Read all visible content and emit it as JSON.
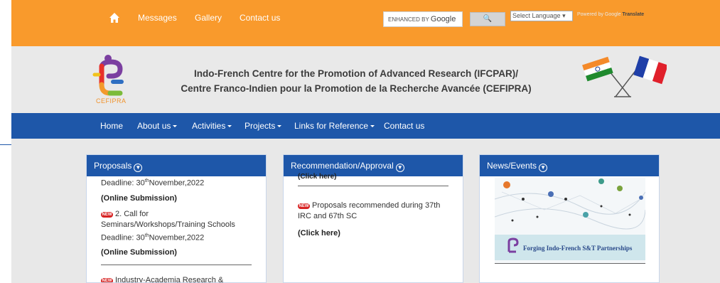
{
  "topbar": {
    "links": [
      "Messages",
      "Gallery",
      "Contact us"
    ],
    "search": {
      "prefix": "ENHANCED BY",
      "brand": "Google",
      "button": "🔍"
    },
    "language": {
      "selected": "Select Language"
    },
    "powered_prefix": "Powered by",
    "powered_brand": "Google",
    "powered_suffix": "Translate"
  },
  "header": {
    "logo_text": "CEFIPRA",
    "title_line1": "Indo-French Centre for the Promotion of Advanced Research (IFCPAR)/",
    "title_line2": "Centre Franco-Indien pour la Promotion de la Recherche Avancée (CEFIPRA)"
  },
  "nav": {
    "items": [
      {
        "label": "Home"
      },
      {
        "label": "About us"
      },
      {
        "label": "Activities"
      },
      {
        "label": "Projects"
      },
      {
        "label": "Links for Reference"
      },
      {
        "label": "Contact us"
      }
    ]
  },
  "proposals": {
    "title": "Proposals",
    "deadline1_prefix": "Deadline: 30",
    "deadline1_sup": "th",
    "deadline1_suffix": "November,2022",
    "online1": "(Online Submission)",
    "new_tag": "NEW",
    "item2_line1": "2. Call for",
    "item2_line2": "Seminars/Workshops/Training Schools",
    "deadline2_prefix": "Deadline: 30",
    "deadline2_sup": "th",
    "deadline2_suffix": "November,2022",
    "online2": "(Online Submission)",
    "item3_partial": "Industry-Academia Research &"
  },
  "recommendation": {
    "title": "Recommendation/Approval",
    "click_top": "(Click here)",
    "new_tag": "NEW",
    "text": "Proposals recommended during 37th IRC and 67th SC",
    "click": "(Click here)"
  },
  "news": {
    "title": "News/Events",
    "banner_text": "Forging Indo-French S&T Partnerships"
  },
  "colors": {
    "orange": "#f99a2c",
    "blue": "#1e57a9",
    "background": "#e8e8e8"
  }
}
